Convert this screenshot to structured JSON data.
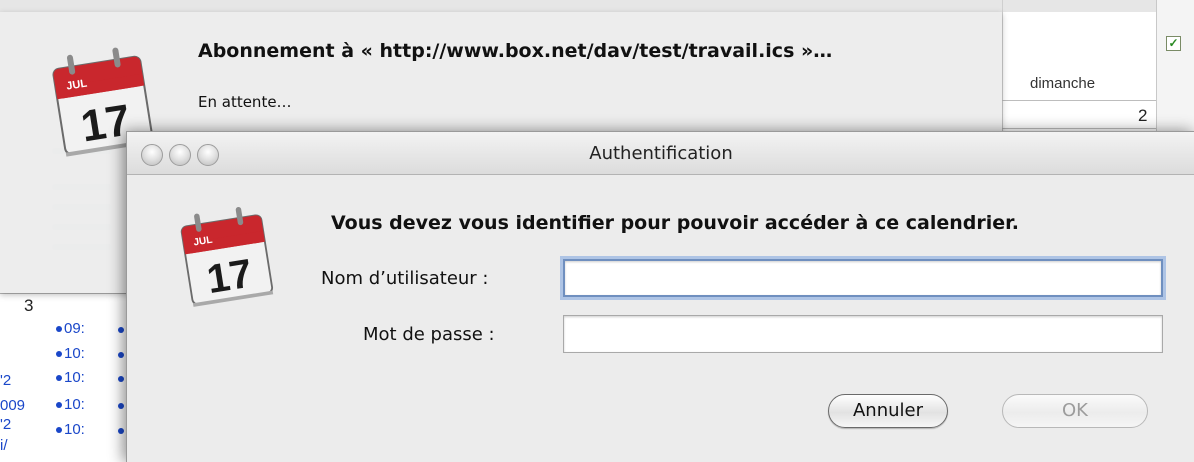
{
  "background": {
    "day_header": "dimanche",
    "day_number_right": "2",
    "day_number_left": "3",
    "events": [
      "09:",
      "10:",
      "10:",
      "10:",
      "10:"
    ],
    "cut_labels": [
      "'2",
      "009",
      "'2",
      "i/"
    ]
  },
  "subscribe_sheet": {
    "title": "Abonnement à « http://www.box.net/dav/test/travail.ics »…",
    "status": "En attente…",
    "icon": "ical-calendar-icon",
    "icon_month": "JUL",
    "icon_day": "17"
  },
  "dialog": {
    "title": "Authentification",
    "message": "Vous devez vous identifier pour pouvoir accéder à ce calendrier.",
    "username_label": "Nom d’utilisateur :",
    "username_value": "",
    "password_label": "Mot de passe :",
    "password_value": "",
    "cancel_label": "Annuler",
    "ok_label": "OK",
    "icon": "ical-calendar-icon",
    "icon_month": "JUL",
    "icon_day": "17"
  },
  "colors": {
    "event_blue": "#1a47c9",
    "focus_ring": "#7ca4e0",
    "checkbox_green": "#2a8a23"
  }
}
